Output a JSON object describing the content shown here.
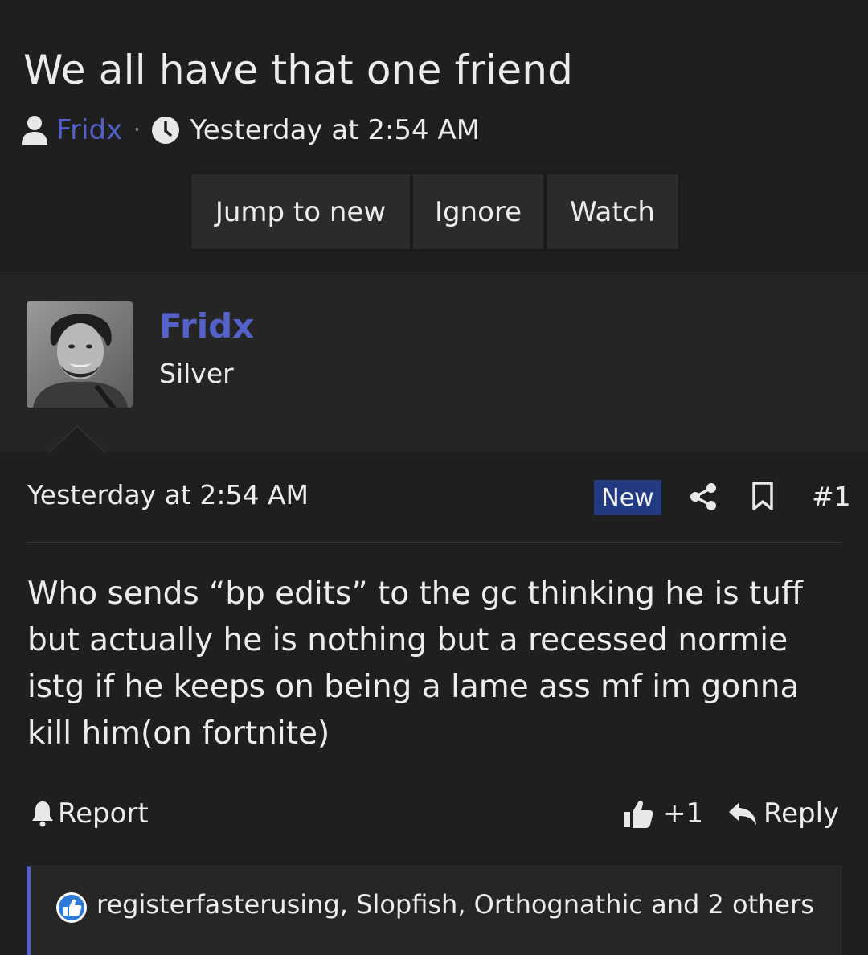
{
  "thread": {
    "title": "We all have that one friend",
    "author": "Fridx",
    "separator": "·",
    "time": "Yesterday at 2:54 AM"
  },
  "buttons": {
    "jump_to_new": "Jump to new",
    "ignore": "Ignore",
    "watch": "Watch"
  },
  "user": {
    "name": "Fridx",
    "title": "Silver"
  },
  "post": {
    "date": "Yesterday at 2:54 AM",
    "badge": "New",
    "number": "#1",
    "message": "Who sends “bp edits” to the gc thinking he is tuff\nbut actually he is nothing but a recessed normie\nistg if he keeps on being a lame ass mf im gonna\nkill him(on fortnite)"
  },
  "actions": {
    "report": "Report",
    "like_count": "+1",
    "reply": "Reply"
  },
  "reactions": {
    "text": "registerfasterusing, Slopfish, Orthognathic and 2 others"
  },
  "colors": {
    "background": "#1f1f20",
    "user_panel": "#252526",
    "accent": "#5361c8",
    "badge_new": "#223a82"
  },
  "icons": [
    "user-icon",
    "clock-icon",
    "share-icon",
    "bookmark-icon",
    "bell-icon",
    "thumbs-up-icon",
    "reply-icon",
    "like-reaction-icon"
  ]
}
